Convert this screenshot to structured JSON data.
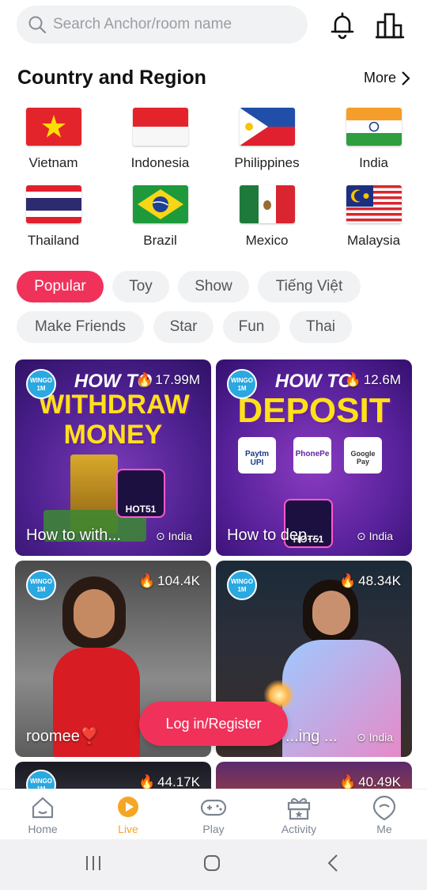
{
  "search": {
    "placeholder": "Search Anchor/room name"
  },
  "icons": {
    "search": "search-icon",
    "bell": "bell-icon",
    "ranking": "ranking-icon",
    "chevron": "chevron-right-icon",
    "location": "location-pin-icon",
    "flame": "flame-icon"
  },
  "section": {
    "title": "Country and Region",
    "more": "More"
  },
  "countries": [
    {
      "name": "Vietnam"
    },
    {
      "name": "Indonesia"
    },
    {
      "name": "Philippines"
    },
    {
      "name": "India"
    },
    {
      "name": "Thailand"
    },
    {
      "name": "Brazil"
    },
    {
      "name": "Mexico"
    },
    {
      "name": "Malaysia"
    }
  ],
  "tags": [
    {
      "label": "Popular",
      "active": true
    },
    {
      "label": "Toy"
    },
    {
      "label": "Show"
    },
    {
      "label": "Tiếng Việt"
    },
    {
      "label": "Make Friends"
    },
    {
      "label": "Star"
    },
    {
      "label": "Fun"
    },
    {
      "label": "Thai"
    }
  ],
  "cards": [
    {
      "badge": "WINGO 1M",
      "viewers": "17.99M",
      "title": "How to with...",
      "location": "India",
      "poster_line1": "HOW TO",
      "poster_line2": "WITHDRAW MONEY",
      "brand": "HOT51"
    },
    {
      "badge": "WINGO 1M",
      "viewers": "12.6M",
      "title": "How to dep...",
      "location": "India",
      "poster_line1": "HOW TO",
      "poster_line2": "DEPOSIT",
      "brand": "HOT51",
      "payments": [
        "Paytm UPI",
        "PhonePe",
        "Google Pay"
      ]
    },
    {
      "badge": "WINGO 1M",
      "viewers": "104.4K",
      "title": "roomee❣️",
      "location": ""
    },
    {
      "badge": "WINGO 1M",
      "viewers": "48.34K",
      "title": "...ing ...",
      "location": "India"
    },
    {
      "badge": "WINGO 1M",
      "viewers": "44.17K"
    },
    {
      "badge": "",
      "viewers": "40.49K"
    }
  ],
  "login_button": "Log in/Register",
  "nav": [
    {
      "label": "Home"
    },
    {
      "label": "Live",
      "active": true
    },
    {
      "label": "Play"
    },
    {
      "label": "Activity"
    },
    {
      "label": "Me"
    }
  ],
  "colors": {
    "accent": "#f0325a",
    "nav_active": "#f5a623",
    "chip_bg": "#f1f2f4"
  }
}
